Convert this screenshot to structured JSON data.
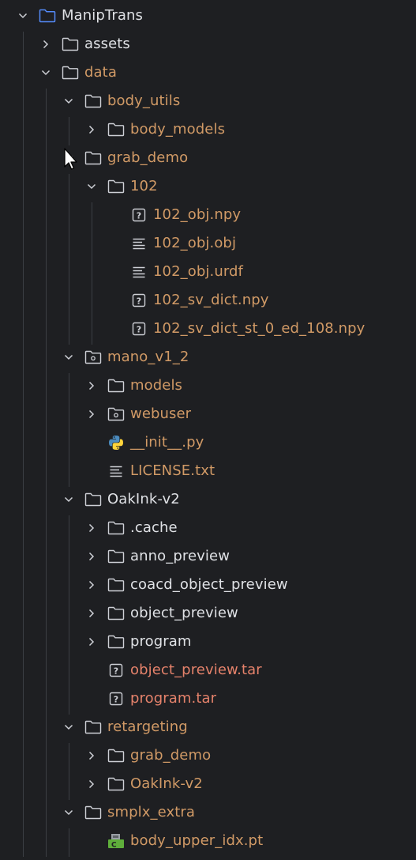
{
  "colors": {
    "background": "#1e1f22",
    "text_default": "#dfe1e5",
    "text_excluded": "#d19a66",
    "text_ignored": "#e5826b",
    "icon": "#ced0d6",
    "guide": "#3c3f44"
  },
  "tree": [
    {
      "label": "ManipTrans",
      "icon": "folder-module-icon",
      "state": "expanded",
      "color": "default"
    },
    {
      "label": "assets",
      "icon": "folder-icon",
      "state": "collapsed",
      "color": "default"
    },
    {
      "label": "data",
      "icon": "folder-icon",
      "state": "expanded",
      "color": "excluded"
    },
    {
      "label": "body_utils",
      "icon": "folder-icon",
      "state": "expanded",
      "color": "excluded"
    },
    {
      "label": "body_models",
      "icon": "folder-icon",
      "state": "collapsed",
      "color": "excluded"
    },
    {
      "label": "grab_demo",
      "icon": "folder-icon",
      "state": "expanded",
      "color": "excluded"
    },
    {
      "label": "102",
      "icon": "folder-icon",
      "state": "expanded",
      "color": "excluded"
    },
    {
      "label": "102_obj.npy",
      "icon": "unknown-file-icon",
      "state": "leaf",
      "color": "excluded"
    },
    {
      "label": "102_obj.obj",
      "icon": "text-file-icon",
      "state": "leaf",
      "color": "excluded"
    },
    {
      "label": "102_obj.urdf",
      "icon": "text-file-icon",
      "state": "leaf",
      "color": "excluded"
    },
    {
      "label": "102_sv_dict.npy",
      "icon": "unknown-file-icon",
      "state": "leaf",
      "color": "excluded"
    },
    {
      "label": "102_sv_dict_st_0_ed_108.npy",
      "icon": "unknown-file-icon",
      "state": "leaf",
      "color": "excluded"
    },
    {
      "label": "mano_v1_2",
      "icon": "package-folder-icon",
      "state": "expanded",
      "color": "excluded"
    },
    {
      "label": "models",
      "icon": "folder-icon",
      "state": "collapsed",
      "color": "excluded"
    },
    {
      "label": "webuser",
      "icon": "package-folder-icon",
      "state": "collapsed",
      "color": "excluded"
    },
    {
      "label": "__init__.py",
      "icon": "python-file-icon",
      "state": "leaf",
      "color": "excluded"
    },
    {
      "label": "LICENSE.txt",
      "icon": "text-file-icon",
      "state": "leaf",
      "color": "excluded"
    },
    {
      "label": "OakInk-v2",
      "icon": "folder-icon",
      "state": "expanded",
      "color": "default"
    },
    {
      "label": ".cache",
      "icon": "folder-icon",
      "state": "collapsed",
      "color": "default"
    },
    {
      "label": "anno_preview",
      "icon": "folder-icon",
      "state": "collapsed",
      "color": "default"
    },
    {
      "label": "coacd_object_preview",
      "icon": "folder-icon",
      "state": "collapsed",
      "color": "default"
    },
    {
      "label": "object_preview",
      "icon": "folder-icon",
      "state": "collapsed",
      "color": "default"
    },
    {
      "label": "program",
      "icon": "folder-icon",
      "state": "collapsed",
      "color": "default"
    },
    {
      "label": "object_preview.tar",
      "icon": "unknown-file-icon",
      "state": "leaf",
      "color": "ignored"
    },
    {
      "label": "program.tar",
      "icon": "unknown-file-icon",
      "state": "leaf",
      "color": "ignored"
    },
    {
      "label": "retargeting",
      "icon": "folder-icon",
      "state": "expanded",
      "color": "excluded"
    },
    {
      "label": "grab_demo",
      "icon": "folder-icon",
      "state": "collapsed",
      "color": "excluded"
    },
    {
      "label": "OakInk-v2",
      "icon": "folder-icon",
      "state": "collapsed",
      "color": "excluded"
    },
    {
      "label": "smplx_extra",
      "icon": "folder-icon",
      "state": "expanded",
      "color": "excluded"
    },
    {
      "label": "body_upper_idx.pt",
      "icon": "torch-file-icon",
      "state": "leaf",
      "color": "excluded"
    }
  ]
}
